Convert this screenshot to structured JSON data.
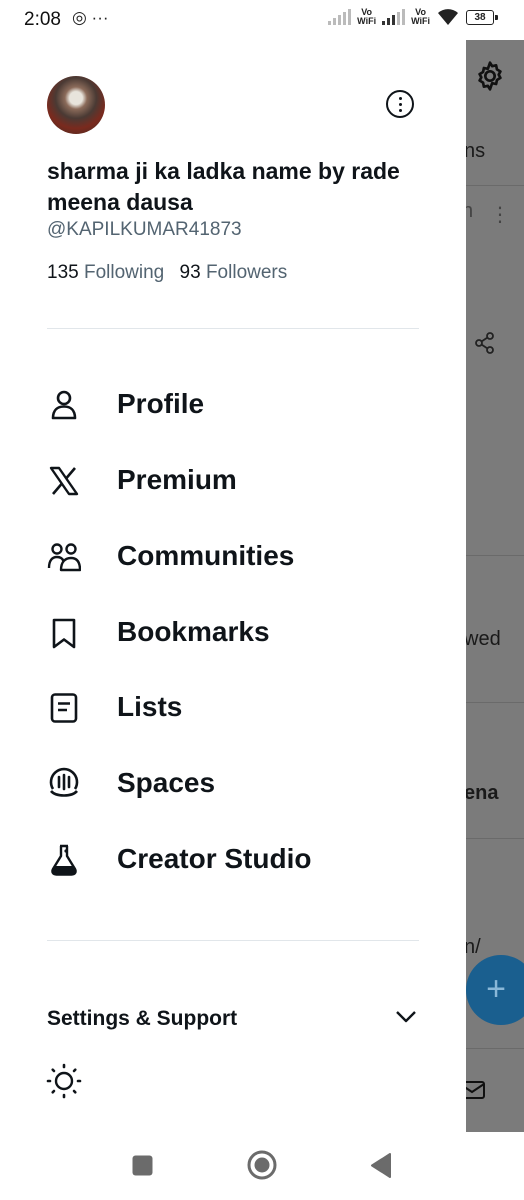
{
  "status_bar": {
    "time": "2:08",
    "left_icons": "◎ ···",
    "sim1_label": "Vo\nWiFi",
    "sim2_label": "Vo\nWiFi",
    "battery": "38"
  },
  "background_app": {
    "fragment_1": "ns",
    "fragment_2": "n",
    "fragment_3": "wed",
    "fragment_4": "ena",
    "fragment_5": "n/"
  },
  "profile": {
    "display_name": "sharma ji ka ladka name by rade meena dausa",
    "handle": "@KAPILKUMAR41873",
    "following_count": "135",
    "following_label": "Following",
    "followers_count": "93",
    "followers_label": "Followers"
  },
  "menu": {
    "items": [
      {
        "label": "Profile",
        "icon": "person-icon"
      },
      {
        "label": "Premium",
        "icon": "x-logo-icon"
      },
      {
        "label": "Communities",
        "icon": "communities-icon"
      },
      {
        "label": "Bookmarks",
        "icon": "bookmark-icon"
      },
      {
        "label": "Lists",
        "icon": "list-icon"
      },
      {
        "label": "Spaces",
        "icon": "spaces-icon"
      },
      {
        "label": "Creator Studio",
        "icon": "flask-icon"
      }
    ]
  },
  "settings": {
    "label": "Settings & Support"
  },
  "colors": {
    "text_primary": "#0f1419",
    "text_secondary": "#536471",
    "overlay": "#7b7b7b",
    "fab": "#1a5f8f"
  }
}
